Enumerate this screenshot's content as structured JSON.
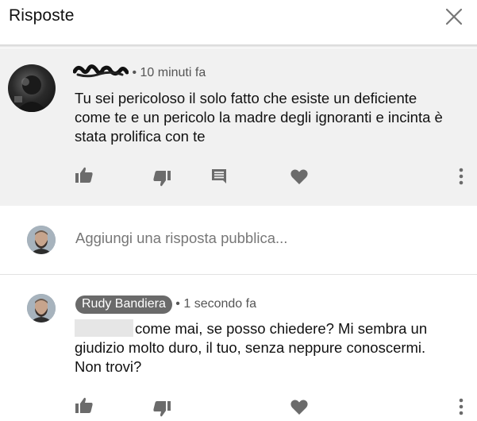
{
  "header": {
    "title": "Risposte",
    "close_icon": "close-icon"
  },
  "parent_comment": {
    "time": "• 10 minuti fa",
    "text": "Tu sei pericoloso il solo fatto che esiste un deficiente come te e un pericolo la madre degli ignoranti e incinta è stata prolifica con te",
    "actions": [
      "like-icon",
      "dislike-icon",
      "reply-icon",
      "heart-icon",
      "more-icon"
    ]
  },
  "reply_box": {
    "placeholder": "Aggiungi una risposta pubblica..."
  },
  "reply": {
    "author": "Rudy Bandiera",
    "time": "• 1 secondo fa",
    "text": "come mai, se posso chiedere? Mi sembra un giudizio molto duro, il tuo, senza neppure conoscermi. Non trovi?",
    "actions": [
      "like-icon",
      "dislike-icon",
      "heart-icon",
      "more-icon"
    ]
  },
  "colors": {
    "parent_bg": "#f1f1f1",
    "icon": "#6b6b6b",
    "chip": "#6a6a6a"
  }
}
